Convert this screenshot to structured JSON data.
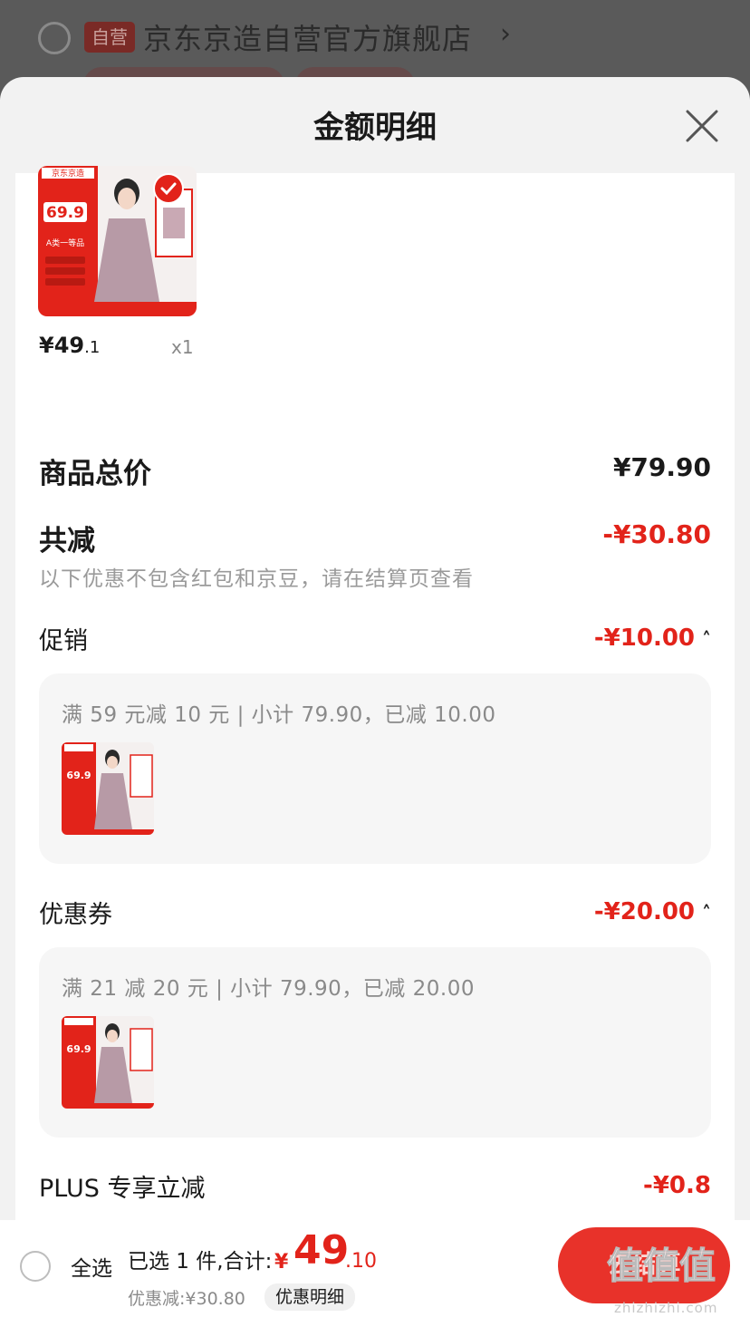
{
  "background_store": {
    "tag": "自营",
    "name": "京东京造自营官方旗舰店",
    "chevron": "›"
  },
  "sheet": {
    "title": "金额明细",
    "close_icon": "close-icon"
  },
  "product": {
    "price_int": "¥49",
    "price_dec": ".1",
    "quantity": "x1",
    "selected": true,
    "thumb": {
      "brand": "京东京造",
      "promo_price": "69.9",
      "line1": "A类一等品"
    }
  },
  "breakdown": {
    "total_label": "商品总价",
    "total_value": "¥79.90",
    "reduce_label": "共减",
    "reduce_value": "-¥30.80",
    "note": "以下优惠不包含红包和京豆，请在结算页查看",
    "promotion": {
      "label": "促销",
      "value": "-¥10.00",
      "caret": "˄",
      "detail": "满 59 元减 10 元 | 小计 79.90，已减 10.00"
    },
    "coupon": {
      "label": "优惠券",
      "value": "-¥20.00",
      "caret": "˄",
      "detail": "满 21 减 20 元 | 小计 79.90，已减 20.00"
    },
    "plus": {
      "label": "PLUS 专享立减",
      "value": "-¥0.8"
    }
  },
  "bottom_bar": {
    "select_all": "全选",
    "summary": "已选 1 件,合计:",
    "currency": "¥",
    "total_int": "49",
    "total_dec": ".10",
    "discount": "优惠减:¥30.80",
    "detail_link": "优惠明细",
    "checkout": "去结算"
  },
  "watermark": {
    "text": "zhizhizhi.com",
    "logo": "值值值"
  },
  "colors": {
    "accent": "#e2231a",
    "background": "#f2f2f2",
    "card": "#ffffff"
  }
}
